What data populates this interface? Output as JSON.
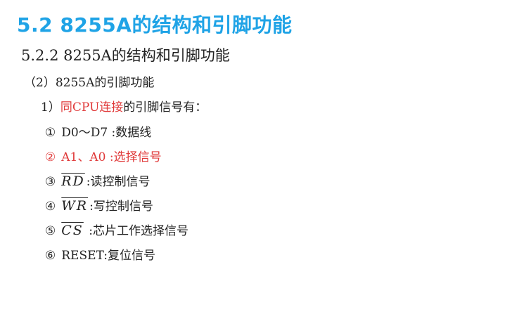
{
  "title": "5.2 8255A的结构和引脚功能",
  "subtitle": "5.2.2 8255A的结构和引脚功能",
  "section": "（2）8255A的引脚功能",
  "subsection": {
    "prefix": "1）",
    "highlight": "同CPU连接",
    "rest": "的引脚信号有："
  },
  "items": [
    {
      "num": "①",
      "label": "D0～D7",
      "desc": " :数据线"
    },
    {
      "num": "②",
      "label": "A1、A0",
      "desc": " :选择信号"
    },
    {
      "num": "③",
      "signal": "RD",
      "desc": ":读控制信号"
    },
    {
      "num": "④",
      "signal": "WR",
      "desc": ":写控制信号"
    },
    {
      "num": "⑤",
      "signal": "CS",
      "desc": " :芯片工作选择信号"
    },
    {
      "num": "⑥",
      "label": "RESET",
      "desc": ":复位信号"
    }
  ],
  "colors": {
    "title": "#1fa3e6",
    "highlight": "#e03a3a",
    "text": "#222222"
  }
}
